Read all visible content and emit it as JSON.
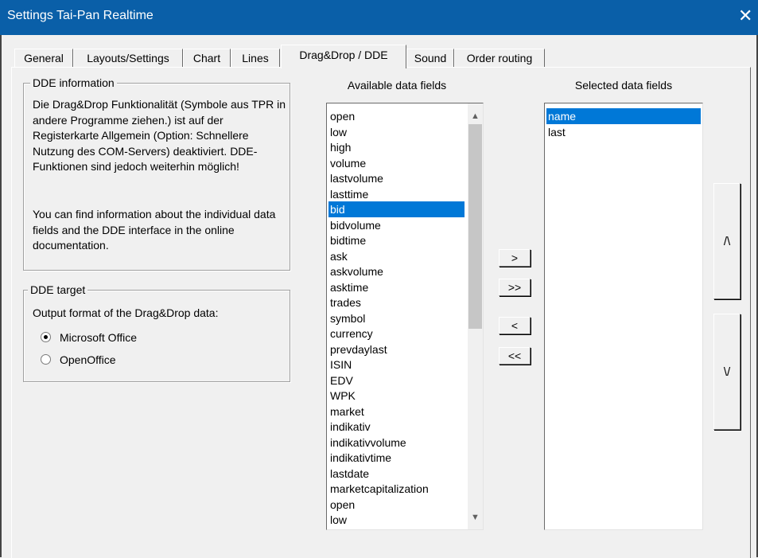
{
  "window": {
    "title": "Settings Tai-Pan Realtime",
    "close_glyph": "✕"
  },
  "tabs": [
    {
      "label": "General"
    },
    {
      "label": "Layouts/Settings"
    },
    {
      "label": "Chart"
    },
    {
      "label": "Lines"
    },
    {
      "label": "Drag&Drop / DDE"
    },
    {
      "label": "Sound"
    },
    {
      "label": "Order routing"
    }
  ],
  "active_tab": "Drag&Drop / DDE",
  "dde_info": {
    "title": "DDE information",
    "para1": "Die Drag&Drop Funktionalität (Symbole aus TPR in andere Programme ziehen.) ist auf der Registerkarte Allgemein (Option: Schnellere Nutzung des COM-Servers) deaktiviert. DDE-Funktionen sind jedoch weiterhin möglich!",
    "para2": "You can find information about the individual data fields and the DDE interface in the online documentation."
  },
  "dde_target": {
    "title": "DDE target",
    "prompt": "Output format of the Drag&Drop data:",
    "options": [
      {
        "label": "Microsoft Office",
        "selected": true
      },
      {
        "label": "OpenOffice",
        "selected": false
      }
    ]
  },
  "available": {
    "label": "Available data fields",
    "items": [
      "open",
      "low",
      "high",
      "volume",
      "lastvolume",
      "lasttime",
      "bid",
      "bidvolume",
      "bidtime",
      "ask",
      "askvolume",
      "asktime",
      "trades",
      "symbol",
      "currency",
      "prevdaylast",
      "ISIN",
      "EDV",
      "WPK",
      "market",
      "indikativ",
      "indikativvolume",
      "indikativtime",
      "lastdate",
      "marketcapitalization",
      "open",
      "low"
    ],
    "selected_index": 6
  },
  "selected": {
    "label": "Selected data fields",
    "items": [
      "name",
      "last"
    ],
    "selected_index": 0
  },
  "buttons": {
    "add": ">",
    "add_all": ">>",
    "remove": "<",
    "remove_all": "<<",
    "move_up": "/\\",
    "move_down": "\\/"
  }
}
